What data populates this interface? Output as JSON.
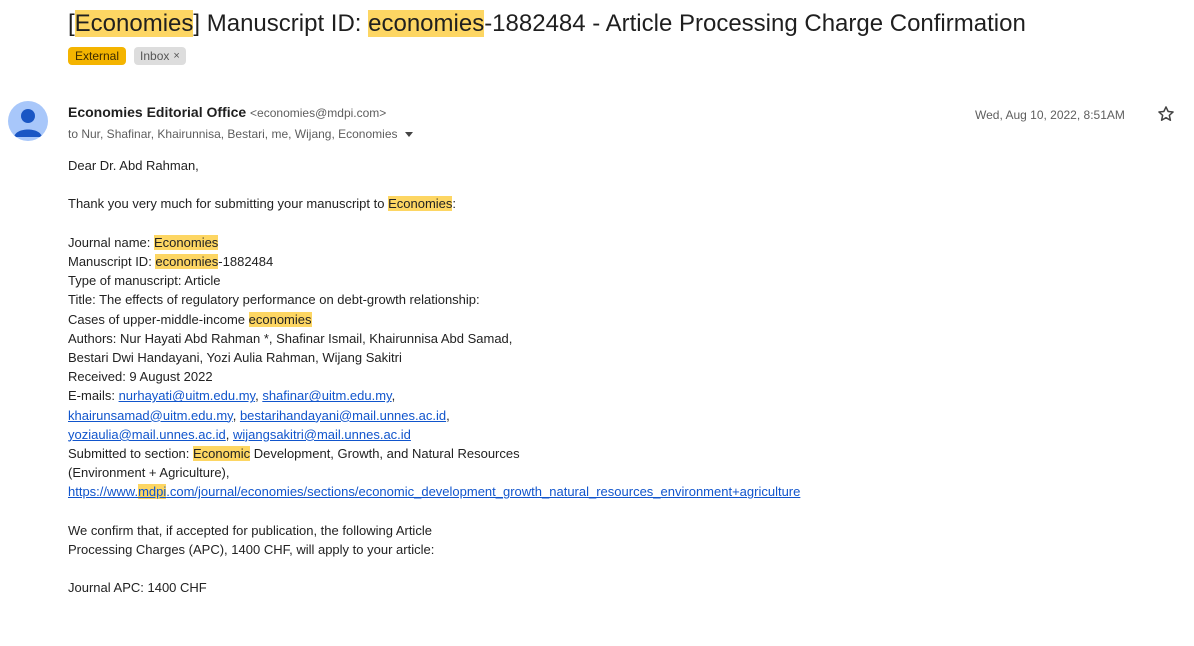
{
  "subject": {
    "bracket_open": "[",
    "journal_hl": "Economies",
    "bracket_close": "] Manuscript ID: ",
    "id_hl": "economies",
    "rest": "-1882484 - Article Processing Charge Confirmation"
  },
  "labels": {
    "external": "External",
    "inbox": "Inbox",
    "inbox_remove": "×"
  },
  "sender": {
    "name": "Economies Editorial Office",
    "email": "<economies@mdpi.com>",
    "to": "to Nur, Shafinar, Khairunnisa, Bestari, me, Wijang, Economies",
    "date": "Wed, Aug 10, 2022, 8:51AM"
  },
  "icons": {
    "avatar": "person-avatar-icon",
    "star": "star-icon",
    "recipients": "chevron-down-icon"
  },
  "colors": {
    "highlight": "#fdd663",
    "external_label": "#f4b400",
    "link": "#1155cc",
    "avatar": "#a8c7fa"
  },
  "body": {
    "greeting": "Dear Dr. Abd Rahman,",
    "thanks_pre": "Thank you very much for submitting your manuscript to ",
    "thanks_hl": "Economies",
    "thanks_post": ":",
    "journal_label": "Journal name: ",
    "journal_value": "Economies",
    "msid_label": "Manuscript ID: ",
    "msid_hl": "economies",
    "msid_rest": "-1882484",
    "type": "Type of manuscript: Article",
    "title1": "Title: The effects of regulatory performance on debt-growth relationship:",
    "title2_pre": "Cases of upper-middle-income ",
    "title2_hl": "economies",
    "authors1": "Authors: Nur Hayati Abd Rahman *, Shafinar Ismail, Khairunnisa Abd Samad,",
    "authors2": "Bestari Dwi Handayani, Yozi Aulia Rahman, Wijang Sakitri",
    "received": "Received: 9 August 2022",
    "emails_label": "E-mails: ",
    "email1": "nurhayati@uitm.edu.my",
    "email2": "shafinar@uitm.edu.my",
    "email3": "khairunsamad@uitm.edu.my",
    "email4": "bestarihandayani@mail.unnes.ac.id",
    "email5": "yoziaulia@mail.unnes.ac.id",
    "email6": "wijangsakitri@mail.unnes.ac.id",
    "section_pre": "Submitted to section: ",
    "section_hl": "Economic",
    "section_post": " Development, Growth, and Natural Resources",
    "section2": "(Environment + Agriculture),",
    "url_pre": "https://www.",
    "url_hl": "mdpi",
    "url_post": ".com/journal/economies/sections/economic_development_growth_natural_resources_environment+agriculture",
    "confirm1": "We confirm that, if accepted for publication, the following Article",
    "confirm2": "Processing Charges (APC), 1400 CHF, will apply to your article:",
    "apc": "Journal APC: 1400 CHF"
  }
}
